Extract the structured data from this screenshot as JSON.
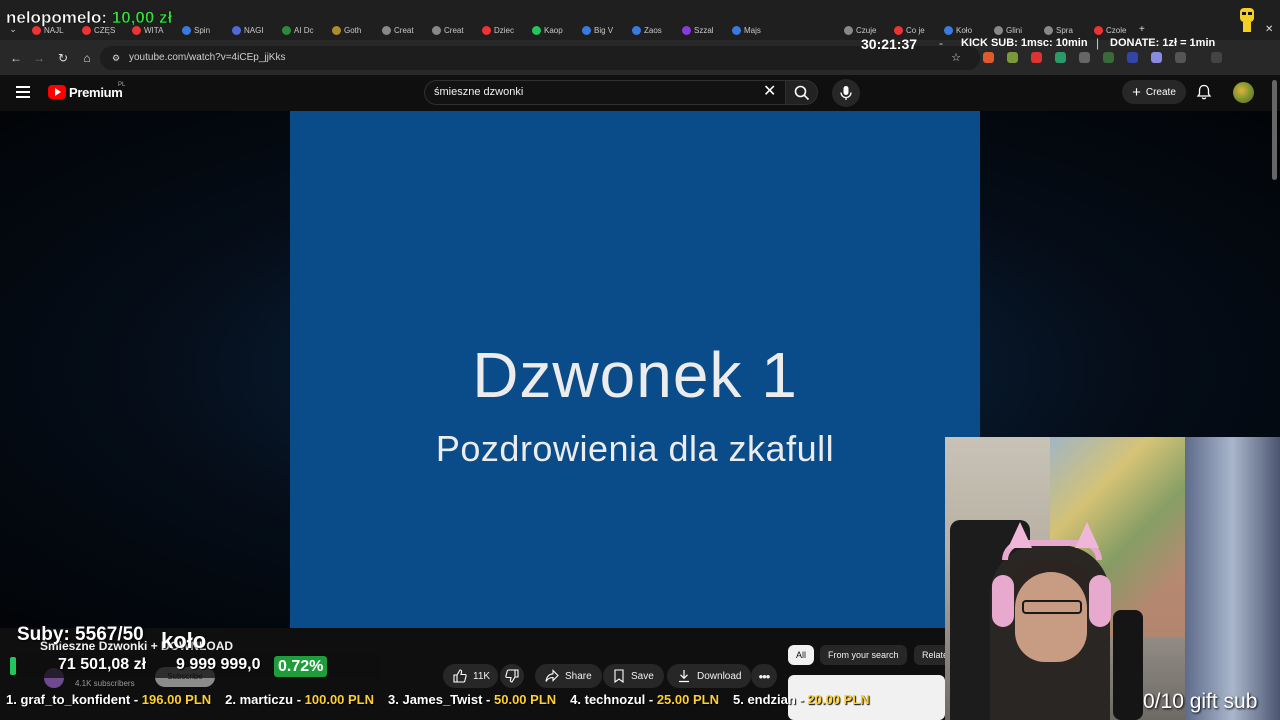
{
  "browser": {
    "tabs": [
      "NAJL",
      "CZĘS",
      "WITA",
      "Spin",
      "NAGI",
      "AI Dc",
      "Goth",
      "Creat",
      "Creat",
      "Dziec",
      "Kaop",
      "Big V",
      "Zaos",
      "Szzal",
      "Majs"
    ],
    "tabs_right": [
      "Czuje",
      "Co je",
      "Koło",
      "Glini",
      "Spra",
      "Czole"
    ],
    "url": "youtube.com/watch?v=4iCEp_jjKks"
  },
  "youtube": {
    "brand": "Premium",
    "region": "PL",
    "search_query": "śmieszne dzwonki",
    "create_label": "Create",
    "channel_title": "Śmieszne Dzwonki + DOWNLOAD",
    "subscribers": "4.1K subscribers",
    "subscribe_label": "Subscribe",
    "likes": "11K",
    "share_label": "Share",
    "save_label": "Save",
    "download_label": "Download",
    "chips": [
      "All",
      "From your search",
      "Relate"
    ]
  },
  "video": {
    "title_line": "Dzwonek 1",
    "subtitle_line": "Pozdrowienia dla zkafull"
  },
  "overlay": {
    "donor_name": "nelopomelo:",
    "donor_amount": "10,00 zł",
    "timer": "30:21:37",
    "separator": "-",
    "kick_sub": "KICK SUB: 1msc: 10min",
    "separator2": "|",
    "donate": "DONATE: 1zł = 1min",
    "subs_goal": "Suby: 5567/50",
    "kolo": "koło",
    "raised": "71 501,08 zł",
    "goal": "9 999 999,0",
    "percent": "0.72%",
    "gift_subs": "0/10 gift sub",
    "donations": [
      {
        "rank": "1. graf_to_konfident - ",
        "amount": "196.00 PLN"
      },
      {
        "rank": "2. marticzu - ",
        "amount": "100.00 PLN"
      },
      {
        "rank": "3. James_Twist - ",
        "amount": "50.00 PLN"
      },
      {
        "rank": "4. technozul - ",
        "amount": "25.00 PLN"
      },
      {
        "rank": "5. endzian - ",
        "amount": "20.00 PLN"
      }
    ]
  }
}
